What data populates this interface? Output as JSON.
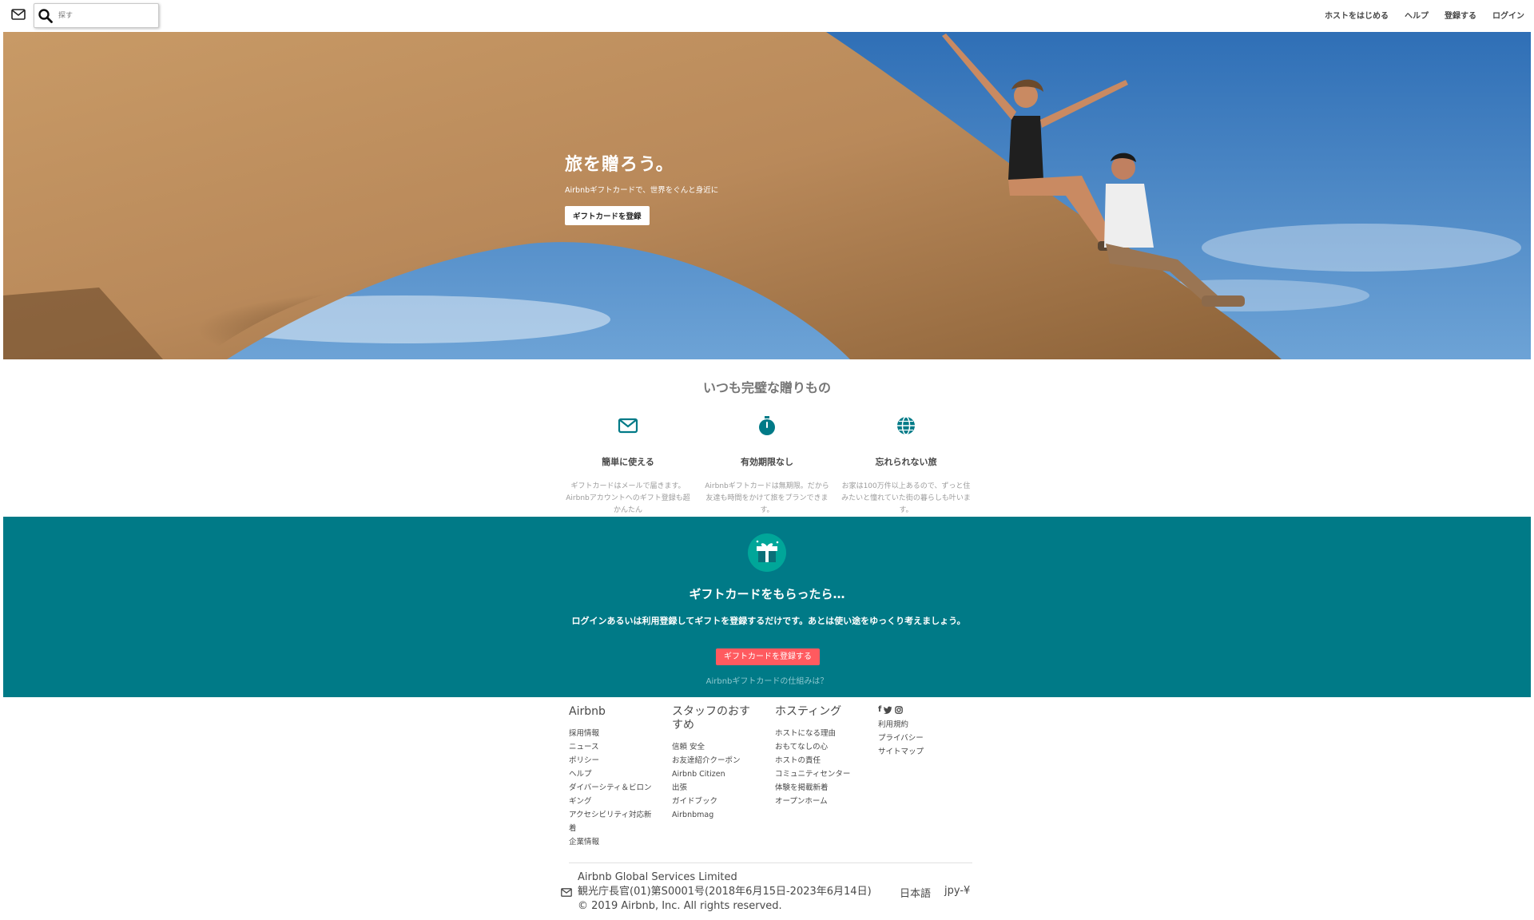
{
  "header": {
    "search_placeholder": "探す",
    "nav": [
      "ホストをはじめる",
      "ヘルプ",
      "登録する",
      "ログイン"
    ]
  },
  "hero": {
    "title": "旅を贈ろう。",
    "subtitle": "Airbnbギフトカードで、世界をぐんと身近に",
    "button": "ギフトカードを登録"
  },
  "features": {
    "title": "いつも完璧な贈りもの",
    "items": [
      {
        "icon": "envelope-icon",
        "title": "簡単に使える",
        "text": "ギフトカードはメールで届きます。Airbnbアカウントへのギフト登録も超かんたん"
      },
      {
        "icon": "stopwatch-icon",
        "title": "有効期限なし",
        "text": "Airbnbギフトカードは無期限。だから友達も時間をかけて旅をプランできます。"
      },
      {
        "icon": "globe-icon",
        "title": "忘れられない旅",
        "text": "お家は100万件以上あるので、ずっと住みたいと憧れていた街の暮らしも叶います。"
      }
    ]
  },
  "redeem": {
    "title": "ギフトカードをもらったら…",
    "text": "ログインあるいは利用登録してギフトを登録するだけです。あとは使い途をゆっくり考えましょう。",
    "button": "ギフトカードを登録する",
    "link": "Airbnbギフトカードの仕組みは？"
  },
  "footer": {
    "columns": [
      {
        "title": "Airbnb",
        "items": [
          "採用情報",
          "ニュース",
          "ポリシー",
          "ヘルプ",
          "ダイバーシティ＆ビロンギング",
          "アクセシビリティ対応新着",
          "企業情報"
        ]
      },
      {
        "title": "スタッフのおすすめ",
        "items": [
          "信頼 安全",
          "お友達紹介クーポン",
          "Airbnb Citizen",
          "出張",
          "ガイドブック",
          "Airbnbmag"
        ]
      },
      {
        "title": "ホスティング",
        "items": [
          "ホストになる理由",
          "おもてなしの心",
          "ホストの責任",
          "コミュニティセンター",
          "体験を掲載新着",
          "オープンホーム"
        ]
      }
    ],
    "social": [
      "f",
      "t",
      "o"
    ],
    "links": [
      "利用規約",
      "プライバシー",
      "サイトマップ"
    ],
    "legal": [
      "Airbnb Global Services Limited",
      "観光庁長官(01)第S0001号(2018年6月15日-2023年6月14日)",
      "© 2019 Airbnb, Inc. All rights reserved."
    ],
    "language": "日本語",
    "currency": "jpy-¥"
  },
  "colors": {
    "teal": "#007a87",
    "coral": "#ff5a5f",
    "text": "#484848"
  }
}
